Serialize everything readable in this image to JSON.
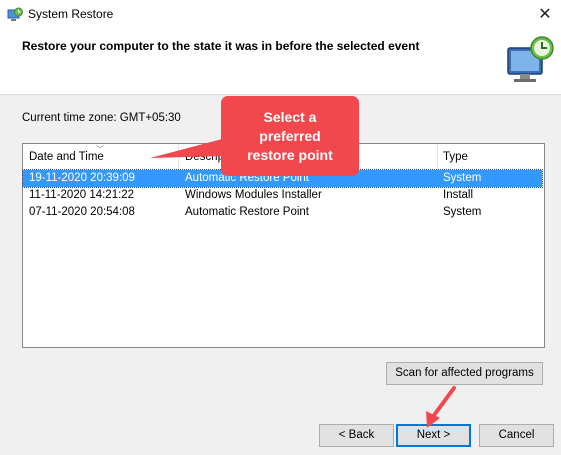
{
  "window": {
    "title": "System Restore",
    "close_glyph": "✕",
    "icon": "system-restore-icon"
  },
  "header": {
    "heading": "Restore your computer to the state it was in before the selected event",
    "icon": "monitor-clock-icon"
  },
  "timezone": "Current time zone: GMT+05:30",
  "list": {
    "columns": [
      "Date and Time",
      "Description",
      "Type"
    ],
    "rows": [
      {
        "date": "19-11-2020 20:39:09",
        "description": "Automatic Restore Point",
        "type": "System",
        "selected": true
      },
      {
        "date": "11-11-2020 14:21:22",
        "description": "Windows Modules Installer",
        "type": "Install",
        "selected": false
      },
      {
        "date": "07-11-2020 20:54:08",
        "description": "Automatic Restore Point",
        "type": "System",
        "selected": false
      }
    ]
  },
  "buttons": {
    "scan": "Scan for affected programs",
    "back": "< Back",
    "next": "Next >",
    "cancel": "Cancel"
  },
  "annotation": {
    "line1": "Select a",
    "line2": "preferred",
    "line3": "restore point",
    "color": "#f2474d"
  }
}
